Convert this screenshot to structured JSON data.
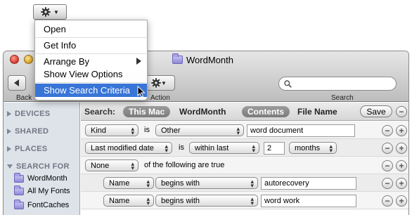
{
  "window": {
    "title": "WordMonth"
  },
  "toolbar": {
    "back_label": "Back",
    "action_label": "Action",
    "search_label": "Search",
    "search_value": ""
  },
  "menu": {
    "items": [
      {
        "label": "Open"
      },
      {
        "label": "Get Info"
      },
      {
        "label": "Arrange By"
      },
      {
        "label": "Show View Options"
      },
      {
        "label": "Show Search Criteria"
      }
    ]
  },
  "sidebar": {
    "sections": [
      {
        "label": "DEVICES"
      },
      {
        "label": "SHARED"
      },
      {
        "label": "PLACES"
      },
      {
        "label": "SEARCH FOR"
      }
    ],
    "items": [
      {
        "label": "WordMonth"
      },
      {
        "label": "All My Fonts"
      },
      {
        "label": "FontCaches"
      }
    ]
  },
  "scope": {
    "label": "Search:",
    "this_mac": "This Mac",
    "folder": "WordMonth",
    "contents": "Contents",
    "file_name": "File Name",
    "save": "Save"
  },
  "criteria": [
    {
      "attribute": "Kind",
      "text": "is",
      "operator": "Other",
      "value": "word document"
    },
    {
      "attribute": "Last modified date",
      "text": "is",
      "operator": "within last",
      "value": "2",
      "unit": "months"
    },
    {
      "attribute": "None",
      "text": "of the following are true"
    },
    {
      "attribute": "Name",
      "operator": "begins with",
      "value": "autorecovery"
    },
    {
      "attribute": "Name",
      "operator": "begins with",
      "value": "word work"
    }
  ],
  "colors": {
    "selection": "#3875d7",
    "sidebar": "#dee3ea"
  }
}
